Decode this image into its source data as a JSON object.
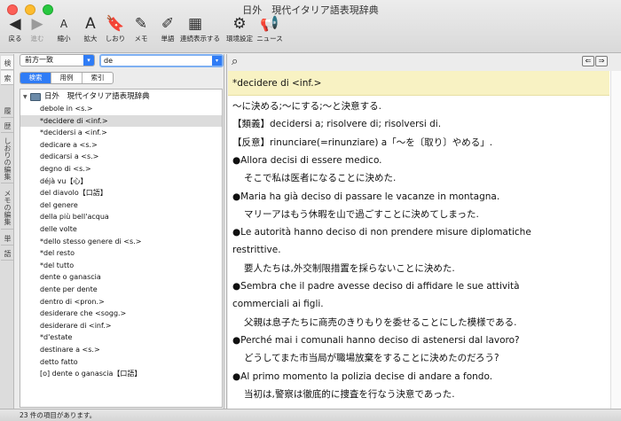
{
  "window": {
    "title": "日外　現代イタリア語表現辞典"
  },
  "toolbar": [
    {
      "icon": "◀",
      "label": "戻る",
      "disabled": false
    },
    {
      "icon": "▶",
      "label": "進む",
      "disabled": true
    },
    {
      "icon": "A",
      "label": "縮小",
      "disabled": false
    },
    {
      "icon": "A",
      "label": "拡大",
      "disabled": false
    },
    {
      "icon": "🔖",
      "label": "しおり",
      "disabled": false
    },
    {
      "icon": "✎",
      "label": "メモ",
      "disabled": false
    },
    {
      "icon": "✐",
      "label": "単語",
      "disabled": false
    },
    {
      "icon": "▦",
      "label": "連続表示する",
      "disabled": false
    },
    {
      "icon": "⚙",
      "label": "環境設定",
      "disabled": false
    },
    {
      "icon": "📢",
      "label": "ニュース",
      "disabled": false
    }
  ],
  "side_tabs": [
    "検",
    "索",
    "履",
    "歴",
    "しおりの編集",
    "メモの編集",
    "単",
    "語"
  ],
  "search": {
    "mode": "前方一致",
    "query": "de",
    "tabs": [
      "検索",
      "用例",
      "索引"
    ],
    "active_tab": "検索"
  },
  "results": {
    "dictionary": "日外　現代イタリア語表現辞典",
    "items": [
      "debole in <s.>",
      "*decidere di <inf.>",
      "*decidersi a <inf.>",
      "dedicare a <s.>",
      "dedicarsi a <s.>",
      "degno di <s.>",
      "déjà vu【心】",
      "del diavolo【口語】",
      "del genere",
      "della più bell'acqua",
      "delle volte",
      "*dello stesso genere di <s.>",
      "*del resto",
      "*del tutto",
      "dente o ganascia",
      "dente per dente",
      "dentro di <pron.>",
      "desiderare che <sogg.>",
      "desiderare di <inf.>",
      "*d'estate",
      "destinare a <s.>",
      "detto fatto",
      "[o] dente o ganascia【口語】"
    ],
    "selected_index": 1
  },
  "entry": {
    "headword": "*decidere di <inf.>",
    "lines": [
      {
        "text": "〜に決める;〜にする;〜と決意する.",
        "indent": false
      },
      {
        "text": "【類義】decidersi a; risolvere di; risolversi di.",
        "indent": false
      },
      {
        "text": "【反意】rinunciare(=rinunziare) a「〜を〔取り〕やめる」.",
        "indent": false
      },
      {
        "text": "●Allora decisi di essere medico.",
        "indent": false
      },
      {
        "text": "そこで私は医者になることに決めた.",
        "indent": true
      },
      {
        "text": "●Maria ha già deciso di passare le vacanze in montagna.",
        "indent": false
      },
      {
        "text": "マリーアはもう休暇を山で過ごすことに決めてしまった.",
        "indent": true
      },
      {
        "text": "●Le autorità hanno deciso di non prendere misure diplomatiche",
        "indent": false
      },
      {
        "text": "restrittive.",
        "indent": false
      },
      {
        "text": "要人たちは,外交制限措置を採らないことに決めた.",
        "indent": true
      },
      {
        "text": "●Sembra che il padre avesse deciso di affidare le sue attività",
        "indent": false
      },
      {
        "text": "commerciali ai figli.",
        "indent": false
      },
      {
        "text": "父親は息子たちに商売のきりもりを委せることにした模様である.",
        "indent": true
      },
      {
        "text": "●Perché mai i comunali hanno deciso di astenersi dal lavoro?",
        "indent": false
      },
      {
        "text": "どうしてまた市当局が職場放棄をすることに決めたのだろう?",
        "indent": true
      },
      {
        "text": "●Al primo momento la polizia decise di andare a fondo.",
        "indent": false
      },
      {
        "text": "当初は,警察は徹底的に捜査を行なう決意であった.",
        "indent": true
      }
    ]
  },
  "status": "23 件の項目があります。"
}
